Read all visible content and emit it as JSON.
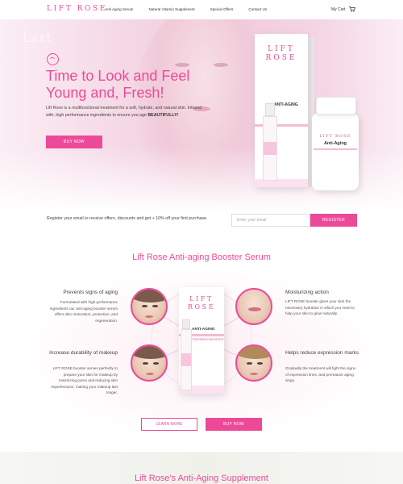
{
  "brand": {
    "logo": "LIFT ROSE",
    "accent": "#ec4a98"
  },
  "nav": {
    "links": [
      "Anti Aging Serum",
      "Natural Vitamin Supplement",
      "Special Offers",
      "Contact Us"
    ],
    "cart_label": "My Cart",
    "cart_icon": "shopping-cart-icon"
  },
  "hero": {
    "watermark": "Lʀst",
    "title": "Time to Look and Feel Young and, Fresh!",
    "description": "Lift Rose is a multifunctional treatment for a soft, hydrate, and natural skin. Infused with, high performance ingredients to ensure you age",
    "description_bold": "BEAUTIFULLY!",
    "buy_button": "BUY NOW",
    "box_logo": "LIFT ROSE",
    "box_tag": "ANTI-AGING",
    "jar_logo": "LIFT ROSE",
    "jar_title": "Anti-Aging"
  },
  "subscribe": {
    "text": "Register your email to receive offers, discounts and get + 10% off your first purchase.",
    "placeholder": "Enter your email",
    "button": "REGISTER"
  },
  "serum": {
    "title": "Lift Rose Anti-aging Booster Serum",
    "box_logo": "LIFT ROSE",
    "box_tag": "ANTI-AGING",
    "box_sub": "TREATMENT BOOSTER",
    "benefits": [
      {
        "title": "Prevents signs of aging",
        "desc": "Formulated with high performance ingredients our anti-aging booster serum offers skin restoration, protection, and regeneration."
      },
      {
        "title": "Moisturizing action",
        "desc": "LIFT ROSE booster gives your skin the necessary hydration in which you need to help your skin to glow naturally."
      },
      {
        "title": "Increase durability of makeup",
        "desc": "LIFT ROSE booster serves perfectly to prepare your skin for makeup by minimizing pores and reducing skin imperfections, making your makeup last longer."
      },
      {
        "title": "Helps reduce expression marks",
        "desc": "Gradually the treatment will fight the signs of expression lines, and premature aging sings."
      }
    ],
    "learn_button": "LEARN MORE",
    "buy_button": "BUY NOW"
  },
  "supplement": {
    "title": "Lift Rose's Anti-Aging Supplement"
  }
}
